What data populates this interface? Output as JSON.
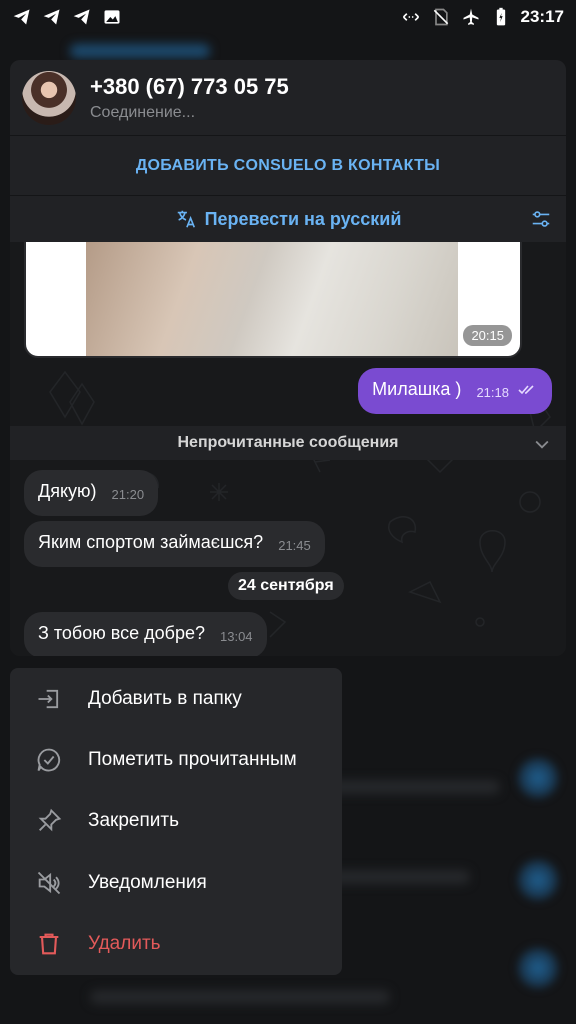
{
  "status_bar": {
    "time": "23:17",
    "left_icons": [
      "telegram-icon",
      "telegram-icon",
      "telegram-icon",
      "image-icon"
    ],
    "right_icons": [
      "data-arrows-icon",
      "no-sim-icon",
      "airplane-icon",
      "battery-icon"
    ]
  },
  "preview": {
    "contact_name": "+380 (67) 773 05 75",
    "contact_status": "Соединение...",
    "add_contact_label": "ДОБАВИТЬ CONSUELO В КОНТАКТЫ",
    "translate_label": "Перевести на русский",
    "photo_time": "20:15",
    "outgoing": {
      "text": "Милашка )",
      "time": "21:18"
    },
    "unread_label": "Непрочитанные сообщения",
    "incoming": [
      {
        "text": "Дякую)",
        "time": "21:20"
      },
      {
        "text": "Яким спортом займаєшся?",
        "time": "21:45"
      }
    ],
    "date_separator": "24 сентября",
    "last_incoming": {
      "text": "З тобою все добре?",
      "time": "13:04"
    }
  },
  "menu": {
    "items": [
      {
        "label": "Добавить в папку",
        "icon": "folder-add-icon"
      },
      {
        "label": "Пометить прочитанным",
        "icon": "mark-read-icon"
      },
      {
        "label": "Закрепить",
        "icon": "pin-icon"
      },
      {
        "label": "Уведомления",
        "icon": "mute-icon"
      },
      {
        "label": "Удалить",
        "icon": "trash-icon"
      }
    ]
  },
  "colors": {
    "accent_blue": "#6ab3f3",
    "outgoing_bubble": "#7a4bd1",
    "danger": "#e35a5a",
    "menu_bg": "#26272a"
  }
}
